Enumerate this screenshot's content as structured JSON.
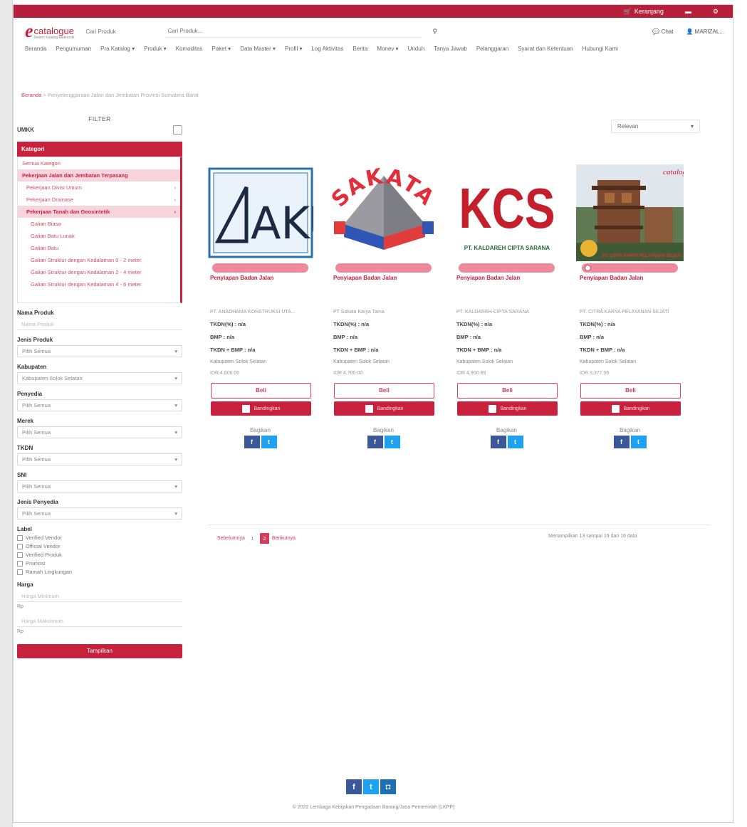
{
  "topbar": {
    "cart_label": "Keranjang",
    "icons": [
      "cart-icon",
      "user-icon",
      "settings-icon"
    ]
  },
  "header": {
    "logo_text": "catalogue",
    "logo_sub": "Sistem Katalog Elektronik",
    "search_type": "Cari Produk",
    "search_placeholder": "Cari Produk...",
    "chat_label": "Chat",
    "user_label": "MARIZAL..."
  },
  "nav": [
    "Beranda",
    "Pengumuman",
    "Pra Katalog ▾",
    "Produk ▾",
    "Komoditas",
    "Paket ▾",
    "Data Master ▾",
    "Profil ▾",
    "Log Aktivitas",
    "Berita",
    "Monev ▾",
    "Unduh",
    "Tanya Jawab",
    "Pelanggaran",
    "Syarat dan Ketentuan",
    "Hubungi Kami"
  ],
  "breadcrumb": {
    "home": "Beranda",
    "sep": ">",
    "current": "Penyelenggaraan Jalan dan Jembatan Provinsi Sumatera Barat"
  },
  "sidebar": {
    "filter_title": "FILTER",
    "umkk_label": "UMKK",
    "kategori_title": "Kategori",
    "kategori_items": [
      {
        "label": "Semua Kategori",
        "level": 0,
        "active": false,
        "arrow": ""
      },
      {
        "label": "Pekerjaan Jalan dan Jembatan Terpasang",
        "level": 0,
        "active": true,
        "arrow": ""
      },
      {
        "label": "Pekerjaan Divisi Umum",
        "level": 1,
        "active": false,
        "arrow": "›"
      },
      {
        "label": "Pekerjaan Drainase",
        "level": 1,
        "active": false,
        "arrow": "›"
      },
      {
        "label": "Pekerjaan Tanah dan Geosintetik",
        "level": 1,
        "active": true,
        "arrow": "›"
      },
      {
        "label": "Galian Biasa",
        "level": 2,
        "active": false,
        "arrow": ""
      },
      {
        "label": "Galian Batu Lunak",
        "level": 2,
        "active": false,
        "arrow": ""
      },
      {
        "label": "Galian Batu",
        "level": 2,
        "active": false,
        "arrow": ""
      },
      {
        "label": "Galian Struktur dengan Kedalaman 0 - 2 meter",
        "level": 2,
        "active": false,
        "arrow": ""
      },
      {
        "label": "Galian Struktur dengan Kedalaman 2 - 4 meter",
        "level": 2,
        "active": false,
        "arrow": ""
      },
      {
        "label": "Galian Struktur dengan Kedalaman 4 - 6 meter",
        "level": 2,
        "active": false,
        "arrow": ""
      }
    ],
    "nama_produk_label": "Nama Produk",
    "nama_produk_placeholder": "Nama Produk",
    "jenis_produk_label": "Jenis Produk",
    "jenis_produk_value": "Pilih Semua",
    "kabupaten_label": "Kabupaten",
    "kabupaten_value": "Kabupaten Solok Selatan",
    "penyedia_label": "Penyedia",
    "penyedia_value": "Pilih Semua",
    "merek_label": "Merek",
    "merek_value": "Pilih Semua",
    "tkdn_label": "TKDN",
    "tkdn_value": "Pilih Semua",
    "sni_label": "SNI",
    "sni_value": "Pilih Semua",
    "jenis_penyedia_label": "Jenis Penyedia",
    "jenis_penyedia_value": "Pilih Semua",
    "label_title": "Label",
    "labels": [
      "Verified Vendor",
      "Official Vendor",
      "Verified Produk",
      "Promosi",
      "Ramah Lingkungan"
    ],
    "harga_label": "Harga",
    "harga_min_placeholder": "Harga Minimum",
    "harga_max_placeholder": "Harga Maksimum",
    "currency": "Rp",
    "tampilkan_label": "Tampilkan"
  },
  "sort": {
    "value": "Relevan"
  },
  "products": [
    {
      "logo": "AKU",
      "title": "Penyiapan Badan Jalan",
      "company": "PT. ANADHAMA KONSTRUKSI UTA...",
      "tkdn": "TKDN(%) : n/a",
      "bmp": "BMP : n/a",
      "tkdn_bmp": "TKDN + BMP : n/a",
      "location": "Kabupaten Solok Selatan",
      "price": "IDR 4,600.00",
      "buy": "Beli",
      "compare": "Bandingkan",
      "share": "Bagikan"
    },
    {
      "logo": "SAKATA",
      "title": "Penyiapan Badan Jalan",
      "company": "PT Sakata Karya Tama",
      "tkdn": "TKDN(%) : n/a",
      "bmp": "BMP : n/a",
      "tkdn_bmp": "TKDN + BMP : n/a",
      "location": "Kabupaten Solok Selatan",
      "price": "IDR 4,700.00",
      "buy": "Beli",
      "compare": "Bandingkan",
      "share": "Bagikan"
    },
    {
      "logo": "KCS",
      "logo_sub": "PT. KALDAREH CIPTA SARANA",
      "title": "Penyiapan Badan Jalan",
      "company": "PT. KALDAREH CIPTA SARANA",
      "tkdn": "TKDN(%) : n/a",
      "bmp": "BMP : n/a",
      "tkdn_bmp": "TKDN + BMP : n/a",
      "location": "Kabupaten Solok Selatan",
      "price": "IDR 4,900.89",
      "buy": "Beli",
      "compare": "Bandingkan",
      "share": "Bagikan"
    },
    {
      "logo": "photo",
      "logo_sub": "PT. CITRA KARYA PELAYANAN SEJATI",
      "title": "Penyiapan Badan Jalan",
      "company": "PT. CITRA KARYA PELAYANAN SEJATI",
      "tkdn": "TKDN(%) : n/a",
      "bmp": "BMP : n/a",
      "tkdn_bmp": "TKDN + BMP : n/a",
      "location": "Kabupaten Solok Selatan",
      "price": "IDR 3,377.06",
      "buy": "Beli",
      "compare": "Bandingkan",
      "share": "Bagikan"
    }
  ],
  "pager": {
    "prev": "Sebelumnya",
    "pages": [
      "1",
      "2"
    ],
    "current": "2",
    "next": "Berikutnya",
    "showing": "Menampilkan 13 sampai 16 dari 16 data"
  },
  "footer": {
    "copyright": "© 2022 Lembaga Kebijakan Pengadaan Barang/Jasa Pemerintah (LKPP)"
  },
  "colors": {
    "brand": "#c8213e",
    "accent": "#d63b57",
    "facebook": "#3b5998",
    "twitter": "#1da1f2"
  }
}
